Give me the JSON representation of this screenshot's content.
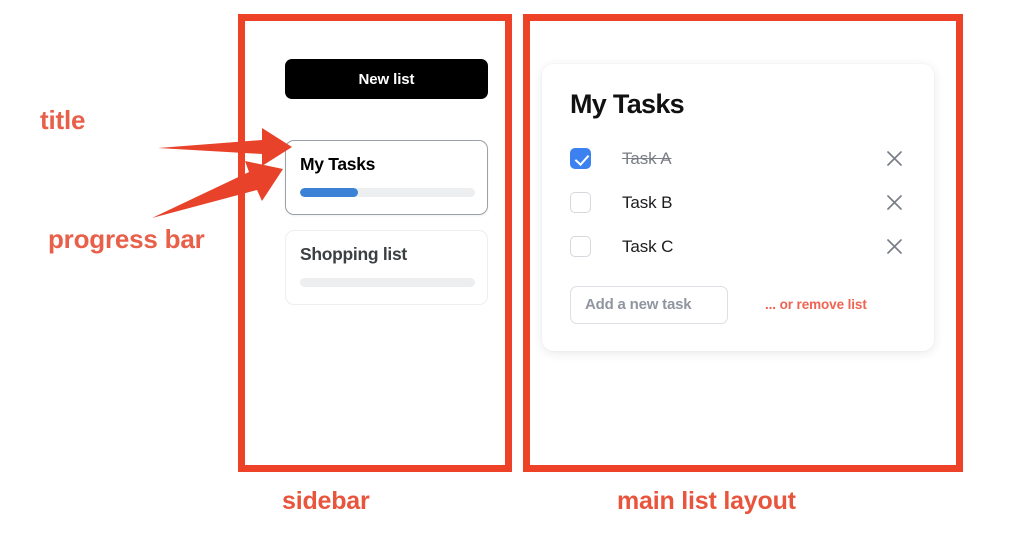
{
  "annotations": {
    "title_label": "title",
    "progress_label": "progress bar",
    "sidebar_label": "sidebar",
    "main_label": "main list layout",
    "accent_color": "#EE4228"
  },
  "sidebar": {
    "new_list_button": "New list",
    "lists": [
      {
        "name": "My Tasks",
        "selected": true,
        "progress_percent": 33
      },
      {
        "name": "Shopping list",
        "selected": false,
        "progress_percent": 0
      }
    ]
  },
  "main": {
    "list_title": "My Tasks",
    "tasks": [
      {
        "label": "Task A",
        "done": true,
        "remove_icon": "close-icon"
      },
      {
        "label": "Task B",
        "done": false,
        "remove_icon": "close-icon"
      },
      {
        "label": "Task C",
        "done": false,
        "remove_icon": "close-icon"
      }
    ],
    "add_task_placeholder": "Add a new task",
    "add_task_value": "",
    "remove_list_link": "... or remove list",
    "link_color": "#EF6352",
    "checkbox_color": "#3b82f0"
  }
}
